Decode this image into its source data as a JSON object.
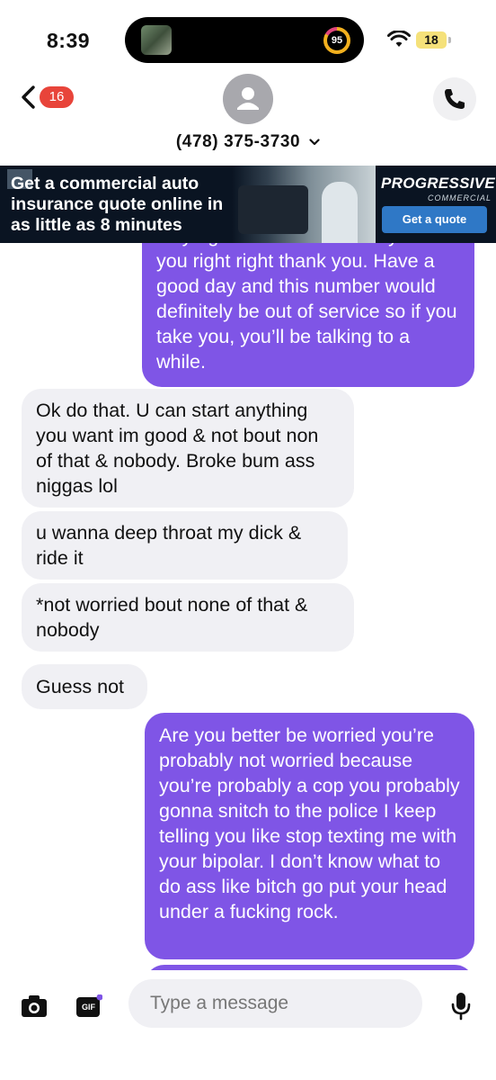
{
  "status_bar": {
    "time": "8:39",
    "activity_value": "95",
    "battery": "18"
  },
  "header": {
    "unread_count": "16",
    "contact_name": "(478) 375-3730"
  },
  "ad": {
    "headline": "Get a commercial auto insurance quote online in as little as 8 minutes",
    "brand": "PROGRESSIVE",
    "brand_sub": "COMMERCIAL",
    "cta": "Get a quote"
  },
  "messages": [
    {
      "direction": "sent",
      "text": "only right . I have somebody stalk you right right thank you. Have a good day and this number would definitely be out of service so if you take you, you’ll be talking to a while."
    },
    {
      "direction": "received",
      "text": "Ok do that. U can start anything you want im good & not bout non of that & nobody. Broke bum ass niggas lol"
    },
    {
      "direction": "received",
      "text": "u wanna deep throat my dick & ride it"
    },
    {
      "direction": "received",
      "text": "*not worried bout none of that & nobody"
    },
    {
      "direction": "received",
      "text": "Guess not"
    },
    {
      "direction": "sent",
      "text": "Are you better be worried you’re probably not worried because you’re probably a cop you probably gonna snitch to the police I keep telling you like stop texting me with your bipolar. I don’t know what to do ass like bitch go put your head under a fucking rock."
    }
  ],
  "composer": {
    "placeholder": "Type a message",
    "gif_label": "GIF"
  },
  "colors": {
    "sent_bubble": "#7f55e6",
    "received_bubble": "#f0f0f4",
    "badge": "#e8443a",
    "ad_background": "#0a1422",
    "ad_button": "#2f78c6"
  },
  "icons": [
    "wifi-icon",
    "back-chevron-icon",
    "person-icon",
    "phone-icon",
    "chevron-down-icon",
    "camera-icon",
    "gif-icon",
    "microphone-icon"
  ]
}
